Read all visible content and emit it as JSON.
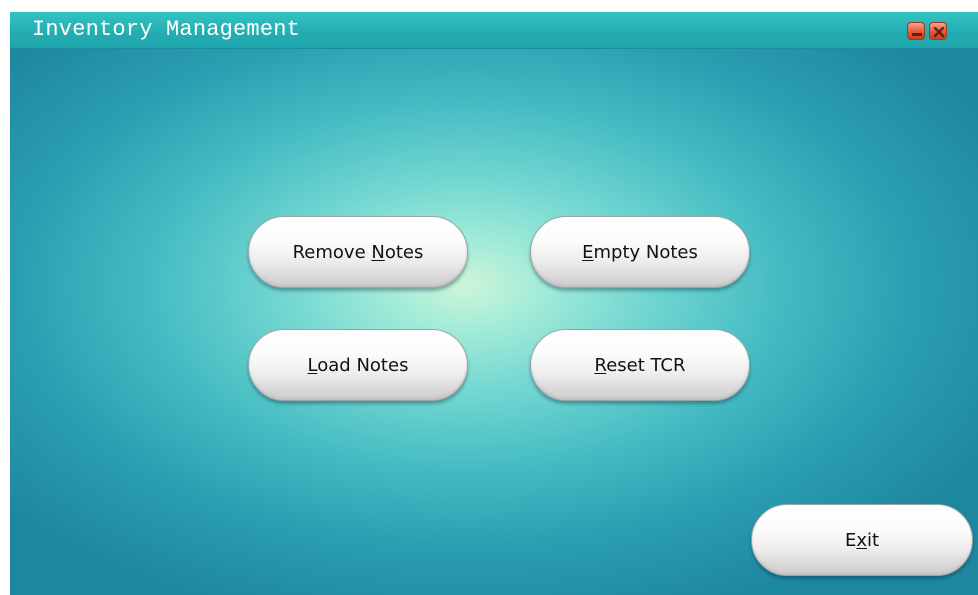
{
  "window": {
    "title": "Inventory Management",
    "controls": {
      "minimize_icon": "minimize-icon",
      "close_icon": "close-icon"
    }
  },
  "buttons": {
    "remove_notes": {
      "before": "Remove ",
      "accel": "N",
      "after": "otes"
    },
    "empty_notes": {
      "before": "",
      "accel": "E",
      "after": "mpty Notes"
    },
    "load_notes": {
      "before": "",
      "accel": "L",
      "after": "oad Notes"
    },
    "reset_tcr": {
      "before": "",
      "accel": "R",
      "after": "eset TCR"
    },
    "exit": {
      "before": "E",
      "accel": "x",
      "after": "it"
    }
  },
  "colors": {
    "titlebar": "#23adb2",
    "background_center": "#cdf5d9",
    "background_edge": "#1e87a0",
    "window_control": "#e3583b"
  }
}
